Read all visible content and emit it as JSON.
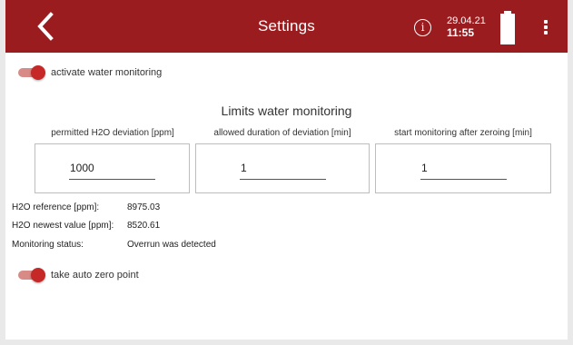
{
  "header": {
    "title": "Settings",
    "info_symbol": "i",
    "date": "29.04.21",
    "time": "11:55",
    "back_icon": "chevron-left-icon",
    "battery_icon": "battery-full-icon",
    "more_icon": "more-vert-icon",
    "bg_color": "#9a1c1f"
  },
  "water_monitoring_toggle": {
    "label": "activate water monitoring",
    "checked": true
  },
  "limits": {
    "title": "Limits water monitoring",
    "fields": [
      {
        "label": "permitted H2O deviation [ppm]",
        "value": "1000"
      },
      {
        "label": "allowed duration of deviation [min]",
        "value": "1"
      },
      {
        "label": "start monitoring after zeroing [min]",
        "value": "1"
      }
    ]
  },
  "status": {
    "reference_label": "H2O reference [ppm]:",
    "reference_value": "8975.03",
    "newest_label": "H2O newest value [ppm]:",
    "newest_value": "8520.61",
    "monitoring_label": "Monitoring status:",
    "monitoring_value": "Overrun was detected"
  },
  "auto_zero_toggle": {
    "label": "take auto zero point",
    "checked": true
  },
  "colors": {
    "accent": "#c62828",
    "toggle_track": "#d88a86"
  }
}
